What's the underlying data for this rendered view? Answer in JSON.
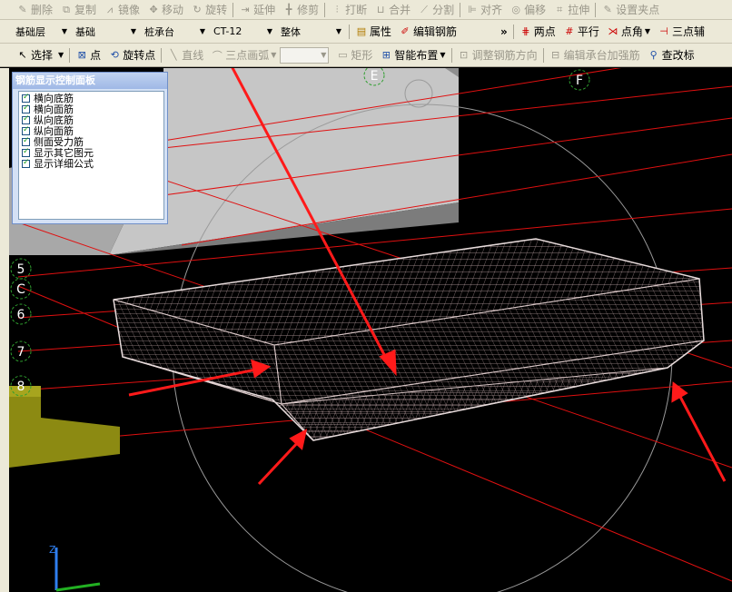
{
  "toolbar1": {
    "items": [
      {
        "icon": "delete-icon",
        "label": "删除",
        "enabled": false
      },
      {
        "icon": "copy-icon",
        "label": "复制",
        "enabled": false
      },
      {
        "icon": "mirror-icon",
        "label": "镜像",
        "enabled": false
      },
      {
        "icon": "move-icon",
        "label": "移动",
        "enabled": false
      },
      {
        "icon": "rotate-icon",
        "label": "旋转",
        "enabled": false
      },
      {
        "icon": "extend-icon",
        "label": "延伸",
        "enabled": false
      },
      {
        "icon": "trim-icon",
        "label": "修剪",
        "enabled": false
      },
      {
        "icon": "break-icon",
        "label": "打断",
        "enabled": false
      },
      {
        "icon": "merge-icon",
        "label": "合并",
        "enabled": false
      },
      {
        "icon": "split-icon",
        "label": "分割",
        "enabled": false
      },
      {
        "icon": "align-icon",
        "label": "对齐",
        "enabled": false
      },
      {
        "icon": "offset-icon",
        "label": "偏移",
        "enabled": false
      },
      {
        "icon": "stretch-icon",
        "label": "拉伸",
        "enabled": false
      },
      {
        "icon": "set-grip-icon",
        "label": "设置夹点",
        "enabled": false
      }
    ]
  },
  "toolbar2": {
    "floor": "基础层",
    "category": "基础",
    "component_type": "桩承台",
    "component_name": "CT-12",
    "mode": "整体",
    "properties_label": "属性",
    "edit_rebar_label": "编辑钢筋",
    "more": "»",
    "two_point_label": "两点",
    "parallel_label": "平行",
    "point_angle_label": "点角",
    "three_point_label": "三点辅"
  },
  "toolbar3": {
    "select_label": "选择",
    "point_label": "点",
    "rotate_point_label": "旋转点",
    "line_label": "直线",
    "arc_label": "三点画弧",
    "rect_label": "矩形",
    "smart_layout_label": "智能布置",
    "adjust_direction_label": "调整钢筋方向",
    "edit_cap_label": "编辑承台加强筋",
    "check_label": "查改标"
  },
  "panel": {
    "title": "钢筋显示控制面板",
    "options": [
      {
        "label": "横向底筋",
        "checked": true
      },
      {
        "label": "横向面筋",
        "checked": true
      },
      {
        "label": "纵向底筋",
        "checked": true
      },
      {
        "label": "纵向面筋",
        "checked": true
      },
      {
        "label": "侧面受力筋",
        "checked": true
      },
      {
        "label": "显示其它图元",
        "checked": true
      },
      {
        "label": "显示详细公式",
        "checked": true
      }
    ]
  },
  "viewport": {
    "axis_labels": [
      "E",
      "F",
      "5",
      "C",
      "6",
      "7",
      "8"
    ],
    "z_axis_label": "Z"
  }
}
